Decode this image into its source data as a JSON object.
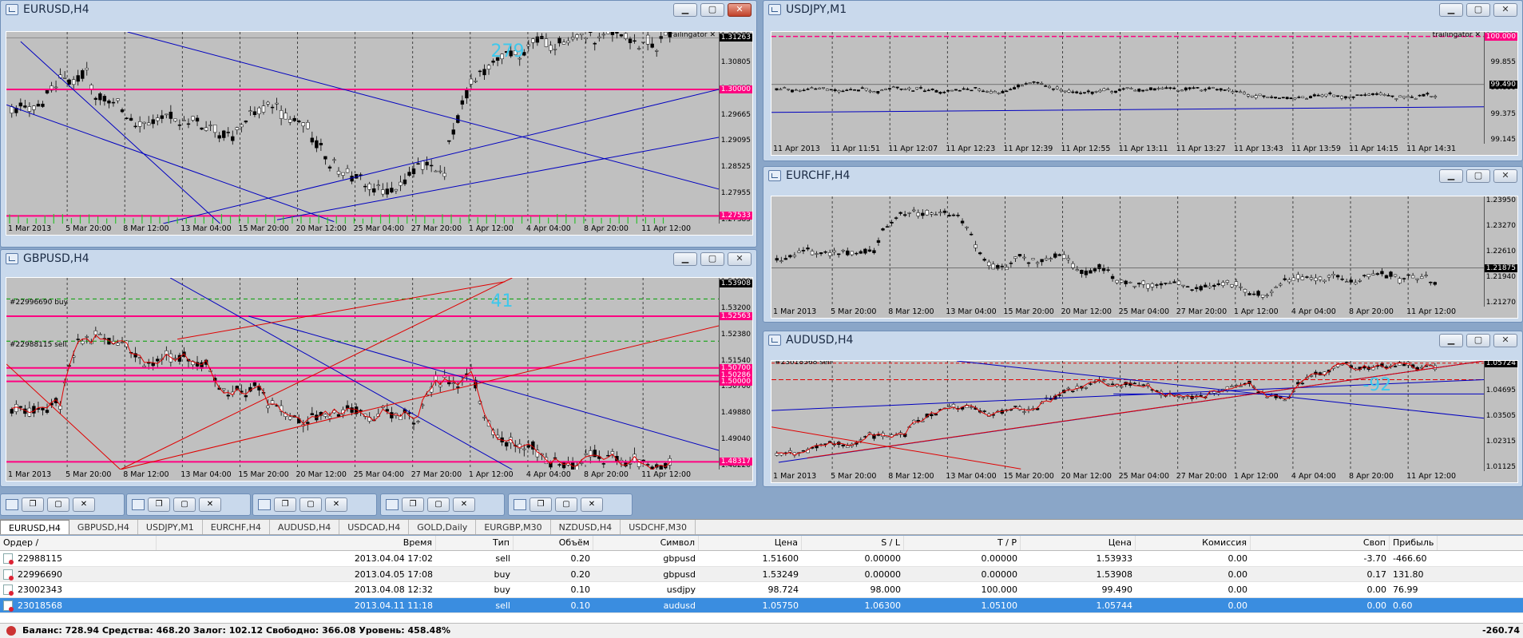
{
  "windows": {
    "eurusd": {
      "title": "EURUSD,H4",
      "indicator": "trailingator",
      "annotation": "279",
      "y_labels": [
        "1.31375",
        "1.30805",
        "1.30235",
        "1.29665",
        "1.29095",
        "1.28525",
        "1.27955",
        "1.27385"
      ],
      "tags": [
        "1.31263",
        "1.30000",
        "1.27533"
      ],
      "x_labels": [
        "1 Mar 2013",
        "5 Mar 20:00",
        "8 Mar 12:00",
        "13 Mar 04:00",
        "15 Mar 20:00",
        "20 Mar 12:00",
        "25 Mar 04:00",
        "27 Mar 20:00",
        "1 Apr 12:00",
        "4 Apr 04:00",
        "8 Apr 20:00",
        "11 Apr 12:00"
      ]
    },
    "gbpusd": {
      "title": "GBPUSD,H4",
      "annotation": "41",
      "order_buy": "#22996690 buy",
      "order_sell": "#22988115 sell",
      "y_labels": [
        "1.54020",
        "1.53200",
        "1.52380",
        "1.51540",
        "1.50700",
        "1.49880",
        "1.49040",
        "1.48220"
      ],
      "tags": [
        "1.53908",
        "1.52563",
        "1.50700",
        "1.50286",
        "1.50000",
        "1.48317"
      ],
      "x_labels": [
        "1 Mar 2013",
        "5 Mar 20:00",
        "8 Mar 12:00",
        "13 Mar 04:00",
        "15 Mar 20:00",
        "20 Mar 12:00",
        "25 Mar 04:00",
        "27 Mar 20:00",
        "1 Apr 12:00",
        "4 Apr 04:00",
        "8 Apr 20:00",
        "11 Apr 12:00"
      ]
    },
    "usdjpy": {
      "title": "USDJPY,M1",
      "indicator": "trailingator",
      "y_labels": [
        "100.065",
        "99.855",
        "99.600",
        "99.375",
        "99.145"
      ],
      "tags": [
        "100.000",
        "99.490"
      ],
      "x_labels": [
        "11 Apr 2013",
        "11 Apr 11:51",
        "11 Apr 12:07",
        "11 Apr 12:23",
        "11 Apr 12:39",
        "11 Apr 12:55",
        "11 Apr 13:11",
        "11 Apr 13:27",
        "11 Apr 13:43",
        "11 Apr 13:59",
        "11 Apr 14:15",
        "11 Apr 14:31"
      ]
    },
    "eurchf": {
      "title": "EURCHF,H4",
      "y_labels": [
        "1.23950",
        "1.23270",
        "1.22610",
        "1.21940",
        "1.21270"
      ],
      "tags": [
        "1.21875"
      ],
      "x_labels": [
        "1 Mar 2013",
        "5 Mar 20:00",
        "8 Mar 12:00",
        "13 Mar 04:00",
        "15 Mar 20:00",
        "20 Mar 12:00",
        "25 Mar 04:00",
        "27 Mar 20:00",
        "1 Apr 12:00",
        "4 Apr 04:00",
        "8 Apr 20:00",
        "11 Apr 12:00"
      ]
    },
    "audusd": {
      "title": "AUDUSD,H4",
      "annotation": "-92",
      "order_sell": "#23018568 sell",
      "y_labels": [
        "1.05695",
        "1.04695",
        "1.03505",
        "1.02315",
        "1.01125"
      ],
      "tags": [
        "1.05724"
      ],
      "x_labels": [
        "1 Mar 2013",
        "5 Mar 20:00",
        "8 Mar 12:00",
        "13 Mar 04:00",
        "15 Mar 20:00",
        "20 Mar 12:00",
        "25 Mar 04:00",
        "27 Mar 20:00",
        "1 Apr 12:00",
        "4 Apr 04:00",
        "8 Apr 20:00",
        "11 Apr 12:00"
      ]
    }
  },
  "tabs": [
    "EURUSD,H4",
    "GBPUSD,H4",
    "USDJPY,M1",
    "EURCHF,H4",
    "AUDUSD,H4",
    "USDCAD,H4",
    "GOLD,Daily",
    "EURGBP,M30",
    "NZDUSD,H4",
    "USDCHF,M30"
  ],
  "table": {
    "headers": [
      "Ордер",
      "Время",
      "Тип",
      "Объём",
      "Символ",
      "Цена",
      "S / L",
      "T / P",
      "Цена",
      "Комиссия",
      "Своп",
      "Прибыль"
    ],
    "rows": [
      [
        "22988115",
        "2013.04.04 17:02",
        "sell",
        "0.20",
        "gbpusd",
        "1.51600",
        "0.00000",
        "0.00000",
        "1.53933",
        "0.00",
        "-3.70",
        "-466.60"
      ],
      [
        "22996690",
        "2013.04.05 17:08",
        "buy",
        "0.20",
        "gbpusd",
        "1.53249",
        "0.00000",
        "0.00000",
        "1.53908",
        "0.00",
        "0.17",
        "131.80"
      ],
      [
        "23002343",
        "2013.04.08 12:32",
        "buy",
        "0.10",
        "usdjpy",
        "98.724",
        "98.000",
        "100.000",
        "99.490",
        "0.00",
        "0.00",
        "76.99"
      ],
      [
        "23018568",
        "2013.04.11 11:18",
        "sell",
        "0.10",
        "audusd",
        "1.05750",
        "1.06300",
        "1.05100",
        "1.05744",
        "0.00",
        "0.00",
        "0.60"
      ]
    ],
    "balance": "Баланс: 728.94  Средства: 468.20  Залог: 102.12  Свободно: 366.08  Уровень: 458.48%",
    "total": "-260.74"
  },
  "colors": {
    "chart_bg": "#c0c0c0",
    "level_line": "#ff0080",
    "trend_line": "#0000c0",
    "channel_line": "#e00000",
    "annotation": "#3ec8ec",
    "selected_row": "#3a8de0"
  }
}
